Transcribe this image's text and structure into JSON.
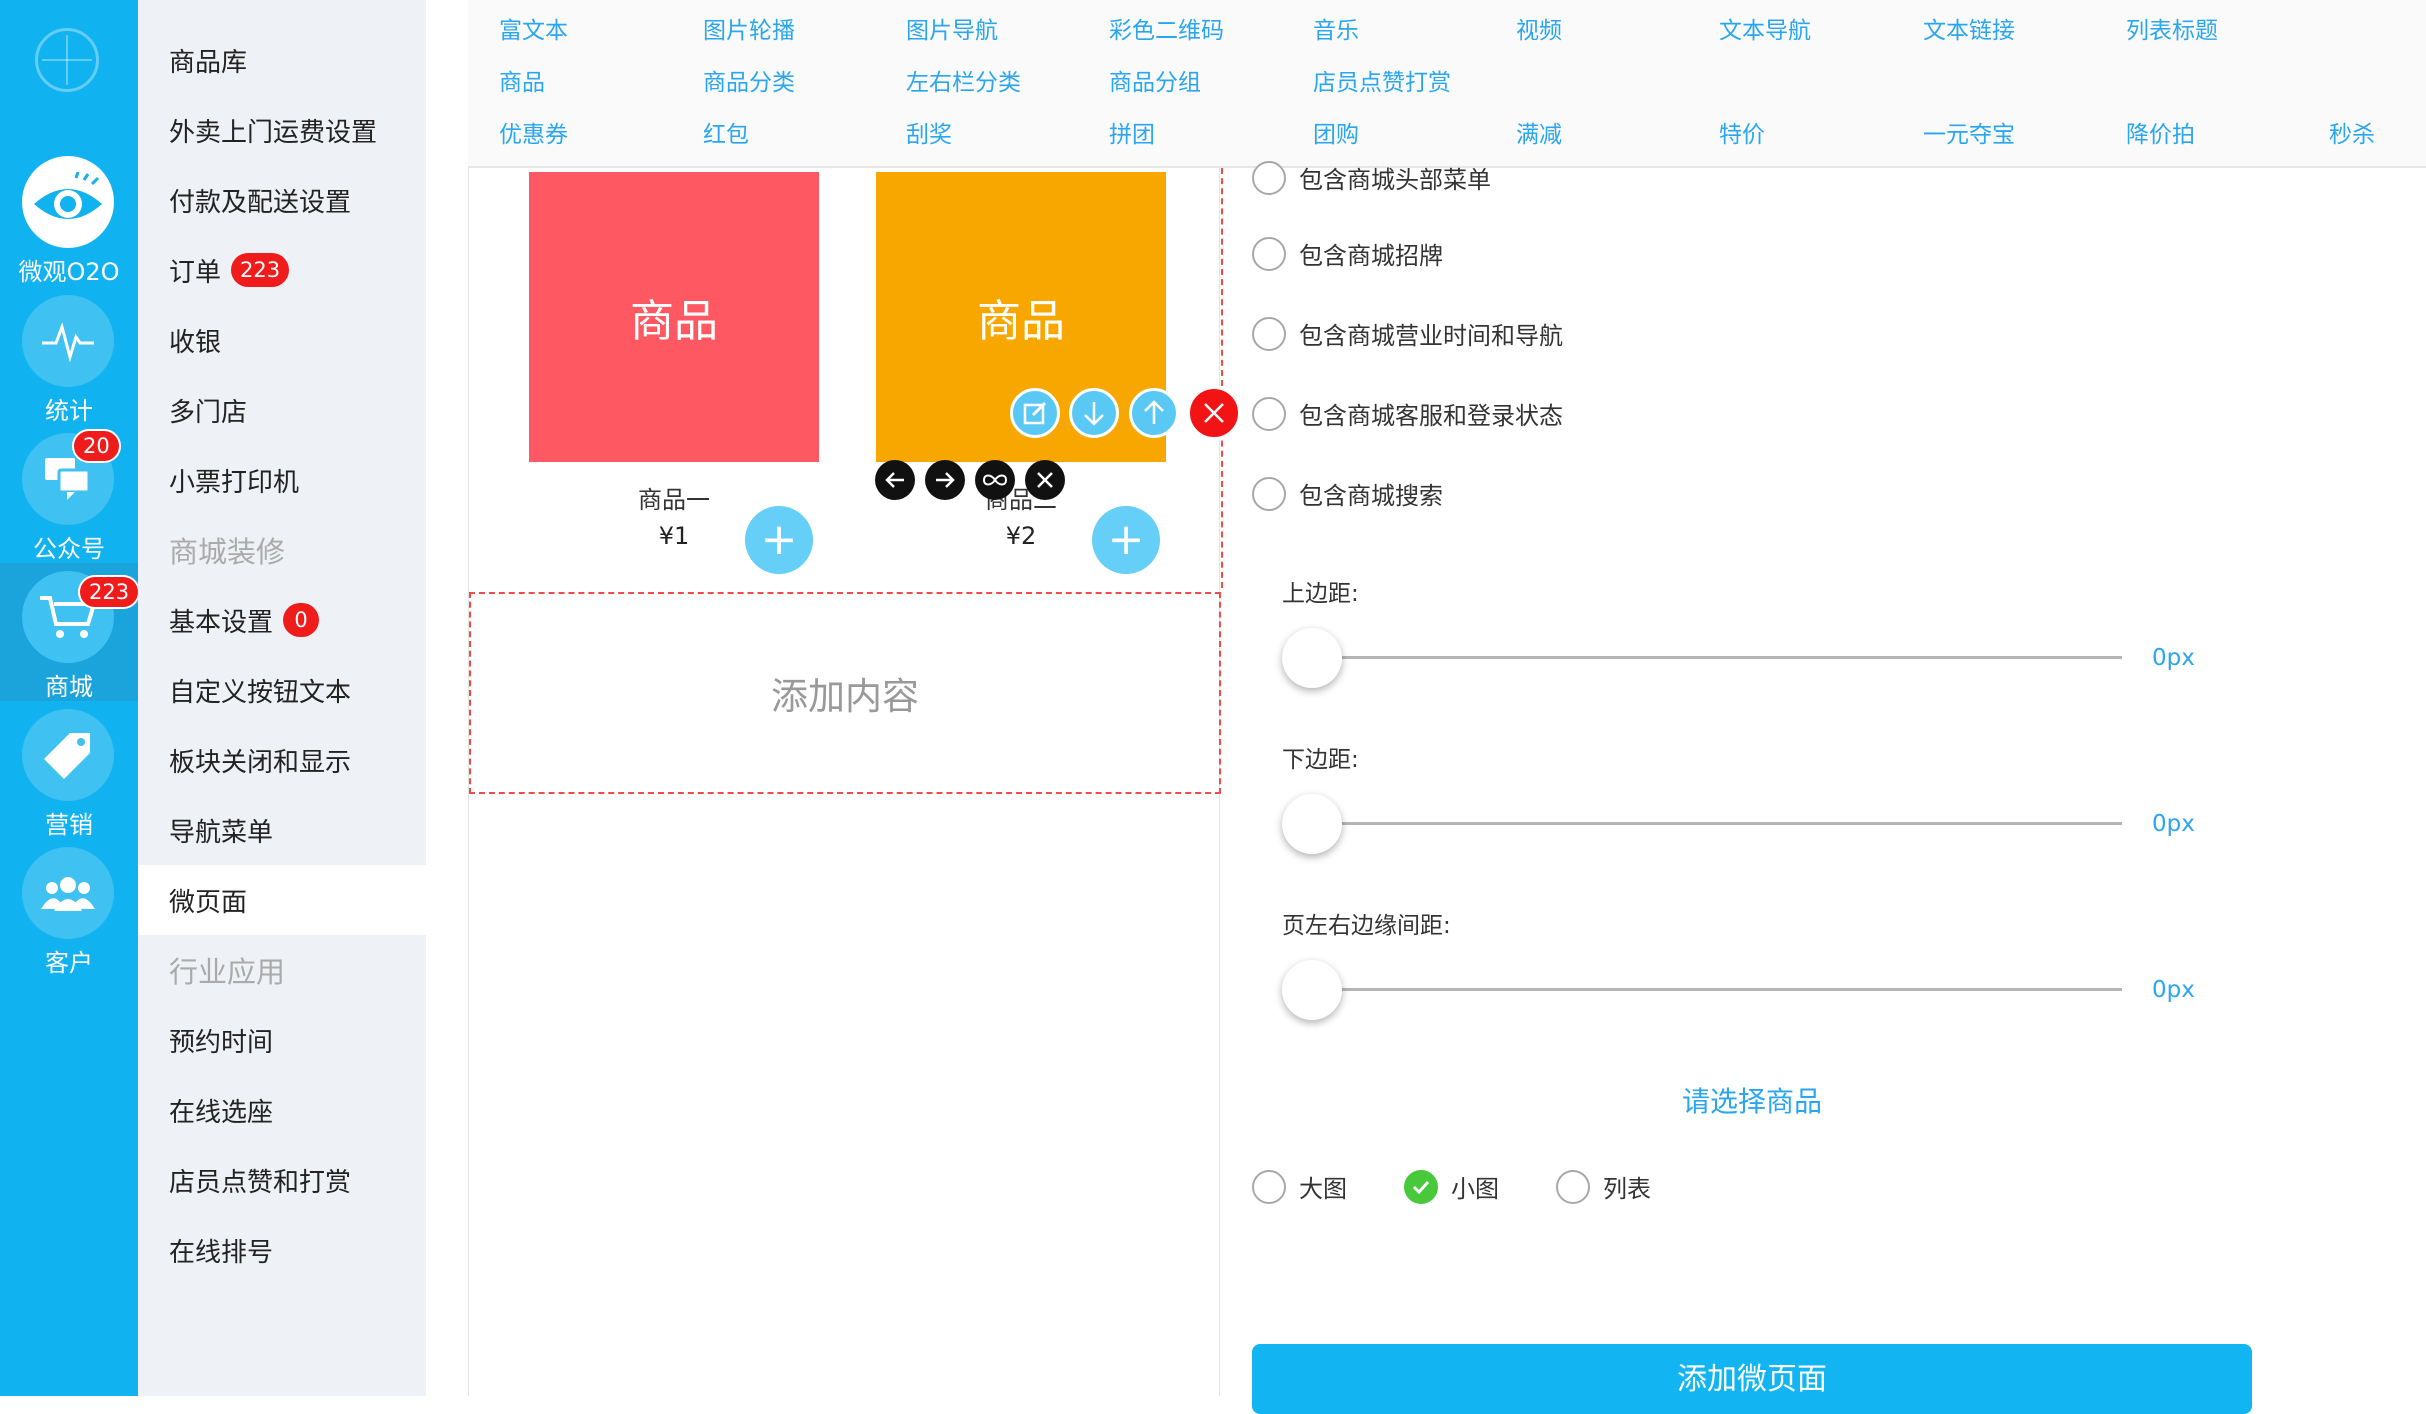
{
  "rail": {
    "items": [
      {
        "label": "微观O2O",
        "badge": ""
      },
      {
        "label": "统计",
        "badge": ""
      },
      {
        "label": "公众号",
        "badge": "20"
      },
      {
        "label": "商城",
        "badge": "223"
      },
      {
        "label": "营销",
        "badge": ""
      },
      {
        "label": "客户",
        "badge": ""
      }
    ]
  },
  "subnav": {
    "items": [
      {
        "label": "商品库",
        "badge": ""
      },
      {
        "label": "外卖上门运费设置",
        "badge": ""
      },
      {
        "label": "付款及配送设置",
        "badge": ""
      },
      {
        "label": "订单",
        "badge": "223"
      },
      {
        "label": "收银",
        "badge": ""
      },
      {
        "label": "多门店",
        "badge": ""
      },
      {
        "label": "小票打印机",
        "badge": ""
      },
      {
        "label": "商城装修",
        "badge": ""
      },
      {
        "label": "基本设置",
        "badge": "0"
      },
      {
        "label": "自定义按钮文本",
        "badge": ""
      },
      {
        "label": "板块关闭和显示",
        "badge": ""
      },
      {
        "label": "导航菜单",
        "badge": ""
      },
      {
        "label": "微页面",
        "badge": ""
      },
      {
        "label": "行业应用",
        "badge": ""
      },
      {
        "label": "预约时间",
        "badge": ""
      },
      {
        "label": "在线选座",
        "badge": ""
      },
      {
        "label": "店员点赞和打赏",
        "badge": ""
      },
      {
        "label": "在线排号",
        "badge": ""
      }
    ]
  },
  "toolbar": {
    "row1": [
      "富文本",
      "图片轮播",
      "图片导航",
      "彩色二维码",
      "音乐",
      "视频",
      "文本导航",
      "文本链接",
      "列表标题"
    ],
    "row2": [
      "商品",
      "商品分类",
      "左右栏分类",
      "商品分组",
      "店员点赞打赏"
    ],
    "row3": [
      "优惠券",
      "红包",
      "刮奖",
      "拼团",
      "团购",
      "满减",
      "特价",
      "一元夺宝",
      "降价拍",
      "秒杀"
    ]
  },
  "canvas": {
    "goods": [
      {
        "image_text": "商品",
        "name": "商品一",
        "price": "¥1",
        "color": "#fe5962",
        "add": "+"
      },
      {
        "image_text": "商品",
        "name": "商品二",
        "price": "¥2",
        "color": "#f7a700",
        "add": "+"
      }
    ],
    "add_content_label": "添加内容"
  },
  "panel": {
    "include_options": [
      "包含商城头部菜单",
      "包含商城招牌",
      "包含商城营业时间和导航",
      "包含商城客服和登录状态",
      "包含商城搜索"
    ],
    "sliders": [
      {
        "label": "上边距:",
        "value": "0px"
      },
      {
        "label": "下边距:",
        "value": "0px"
      },
      {
        "label": "页左右边缘间距:",
        "value": "0px"
      }
    ],
    "select_goods_link": "请选择商品",
    "layout_options": [
      {
        "label": "大图",
        "checked": false
      },
      {
        "label": "小图",
        "checked": true
      },
      {
        "label": "列表",
        "checked": false
      }
    ],
    "submit_label": "添加微页面"
  }
}
